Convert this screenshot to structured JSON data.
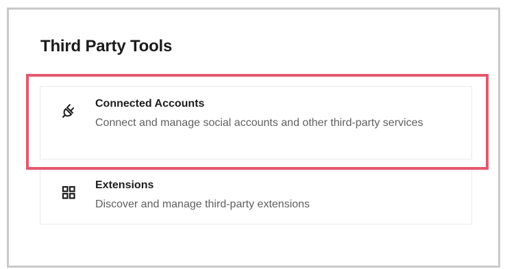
{
  "section": {
    "title": "Third Party Tools"
  },
  "cards": [
    {
      "icon": "plug-icon",
      "title": "Connected Accounts",
      "description": "Connect and manage social accounts and other third-party services"
    },
    {
      "icon": "grid-icon",
      "title": "Extensions",
      "description": "Discover and manage third-party extensions"
    }
  ],
  "colors": {
    "highlight": "#e5576c",
    "title_text": "#1c1c1c",
    "description_text": "#5f5f5f",
    "card_border": "#e8e8e8",
    "frame_border": "#c9c9c9"
  }
}
